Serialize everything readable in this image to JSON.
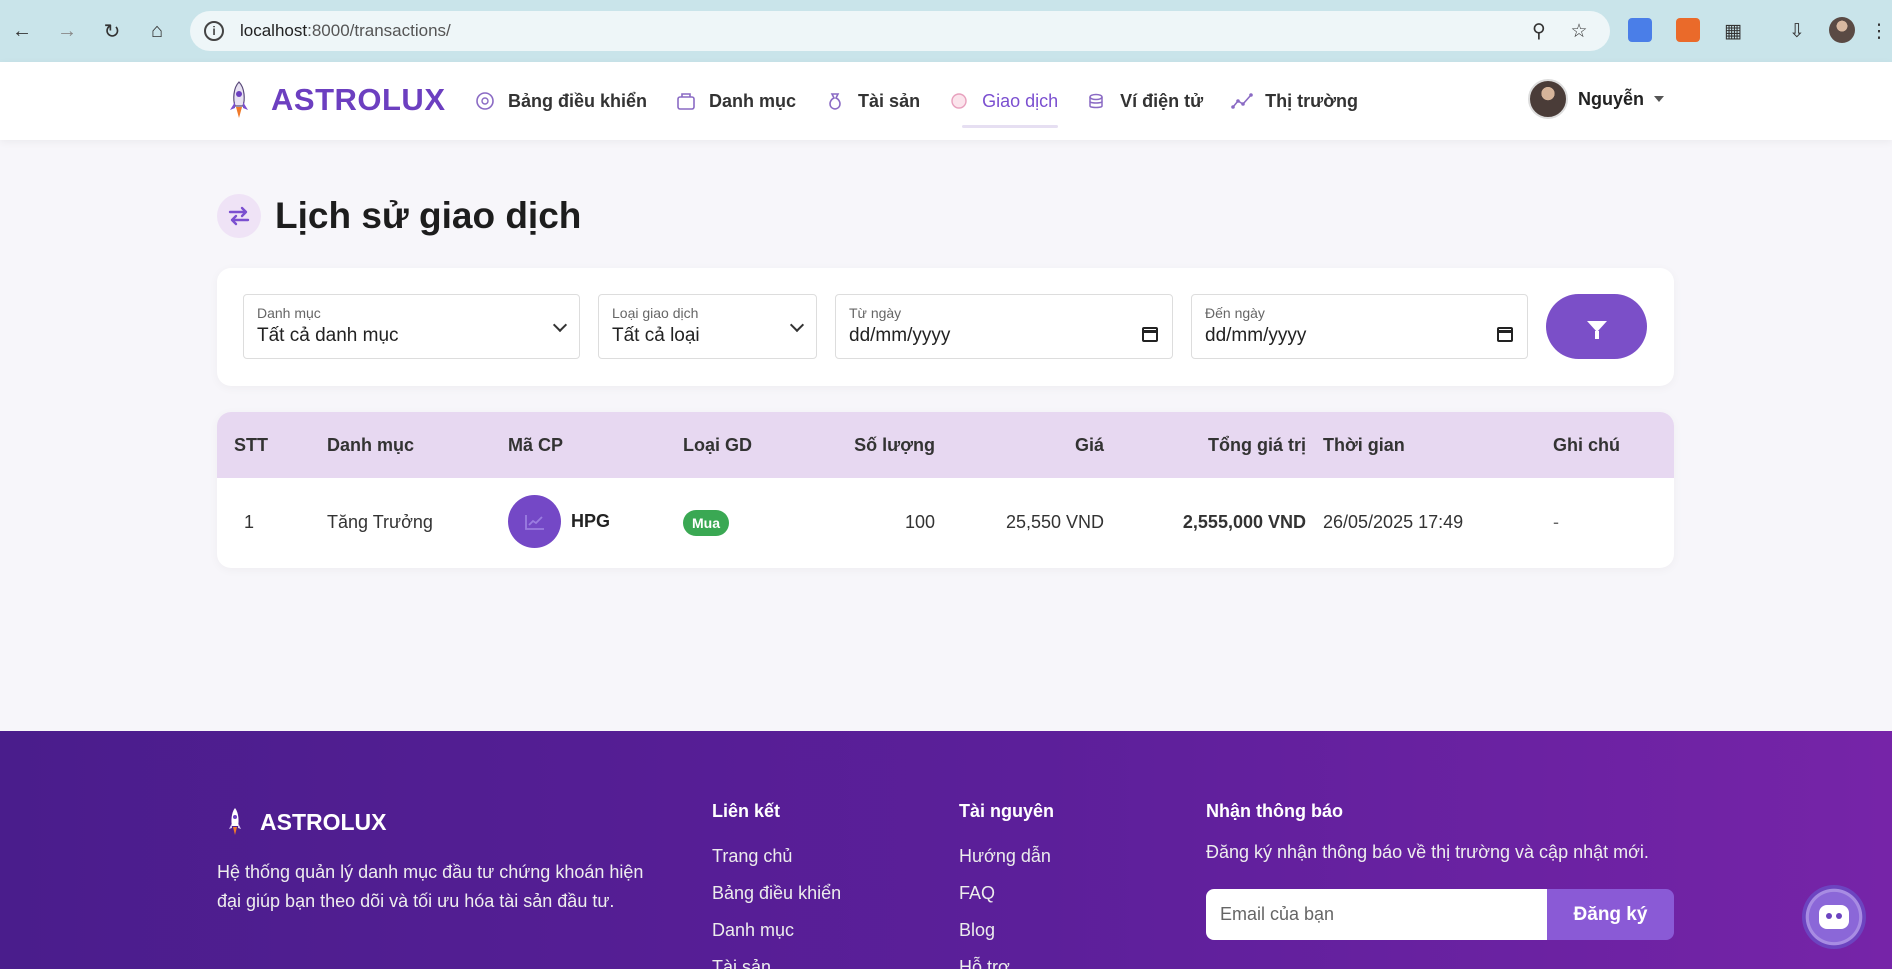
{
  "browser": {
    "url_host": "localhost",
    "url_path": ":8000/transactions/"
  },
  "nav": {
    "brand": "ASTROLUX",
    "links": [
      {
        "label": "Bảng điều khiển",
        "icon": "dashboard-icon"
      },
      {
        "label": "Danh mục",
        "icon": "portfolio-icon"
      },
      {
        "label": "Tài sản",
        "icon": "money-bag-icon"
      },
      {
        "label": "Giao dịch",
        "icon": "transaction-icon",
        "active": true
      },
      {
        "label": "Ví điện tử",
        "icon": "wallet-icon"
      },
      {
        "label": "Thị trường",
        "icon": "market-icon"
      }
    ],
    "user_name": "Nguyễn"
  },
  "page": {
    "title": "Lịch sử giao dịch"
  },
  "filters": {
    "category_label": "Danh mục",
    "category_value": "Tất cả danh mục",
    "type_label": "Loại giao dịch",
    "type_value": "Tất cả loại",
    "from_label": "Từ ngày",
    "from_value": "dd/mm/yyyy",
    "to_label": "Đến ngày",
    "to_value": "dd/mm/yyyy"
  },
  "table": {
    "headers": [
      "STT",
      "Danh mục",
      "Mã CP",
      "Loại GD",
      "Số lượng",
      "Giá",
      "Tổng giá trị",
      "Thời gian",
      "Ghi chú"
    ],
    "rows": [
      {
        "stt": "1",
        "category": "Tăng Trưởng",
        "ticker": "HPG",
        "type": "Mua",
        "quantity": "100",
        "price": "25,550 VND",
        "total": "2,555,000 VND",
        "time": "26/05/2025 17:49",
        "note": "-"
      }
    ]
  },
  "footer": {
    "brand": "ASTROLUX",
    "description": "Hệ thống quản lý danh mục đầu tư chứng khoán hiện đại giúp bạn theo dõi và tối ưu hóa tài sản đầu tư.",
    "links_title": "Liên kết",
    "links": [
      "Trang chủ",
      "Bảng điều khiển",
      "Danh mục",
      "Tài sản"
    ],
    "resources_title": "Tài nguyên",
    "resources": [
      "Hướng dẫn",
      "FAQ",
      "Blog",
      "Hỗ trợ"
    ],
    "news_title": "Nhận thông báo",
    "news_text": "Đăng ký nhận thông báo về thị trường và cập nhật mới.",
    "email_placeholder": "Email của bạn",
    "subscribe_label": "Đăng ký"
  },
  "colors": {
    "brand": "#6c3fc0",
    "table_header": "#e7d8f1",
    "buy_badge": "#3aa853",
    "footer": "#5c1f9a"
  }
}
